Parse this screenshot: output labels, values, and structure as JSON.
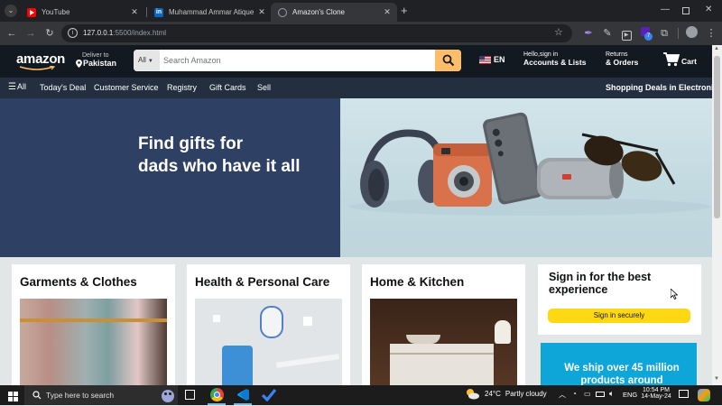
{
  "browser": {
    "tabs": [
      {
        "title": "YouTube",
        "active": false
      },
      {
        "title": "Muhammad Ammar Atique | Li",
        "active": false
      },
      {
        "title": "Amazon's Clone",
        "active": true
      }
    ],
    "new_tab": "+",
    "url_host": "127.0.0.1",
    "url_path": ":5500/index.html",
    "extension_badge": "7"
  },
  "header": {
    "logo": "amazon",
    "deliver_label": "Deliver to",
    "deliver_location": "Pakistan",
    "search_category": "All",
    "search_placeholder": "Search Amazon",
    "language": "EN",
    "account_line1": "Hello,sign in",
    "account_line2": "Accounts & Lists",
    "returns_line1": "Returns",
    "returns_line2": "& Orders",
    "cart_label": "Cart"
  },
  "belt": {
    "all_label": "All",
    "links": [
      "Today's Deal",
      "Customer Service",
      "Registry",
      "Gift Cards",
      "Sell"
    ],
    "promo": "Shopping Deals in Electronics"
  },
  "hero": {
    "line1": "Find gifts for",
    "line2": "dads who have it all"
  },
  "cards": [
    {
      "title": "Garments & Clothes"
    },
    {
      "title": "Health & Personal Care"
    },
    {
      "title": "Home & Kitchen"
    }
  ],
  "signin": {
    "title": "Sign in for the best experience",
    "button": "Sign in securely"
  },
  "ship_banner": "We ship over 45 million products around",
  "taskbar": {
    "search_placeholder": "Type here to search",
    "weather_temp": "24°C",
    "weather_text": "Partly cloudy",
    "lang": "ENG",
    "time": "10:54 PM",
    "date": "14-May-24"
  },
  "colors": {
    "amazon_dark": "#131921",
    "amazon_belt": "#232f3e",
    "search_button": "#febd69",
    "signin_button": "#ffd814",
    "hero_left": "#2e4064",
    "ship_banner": "#0ea5d9"
  }
}
